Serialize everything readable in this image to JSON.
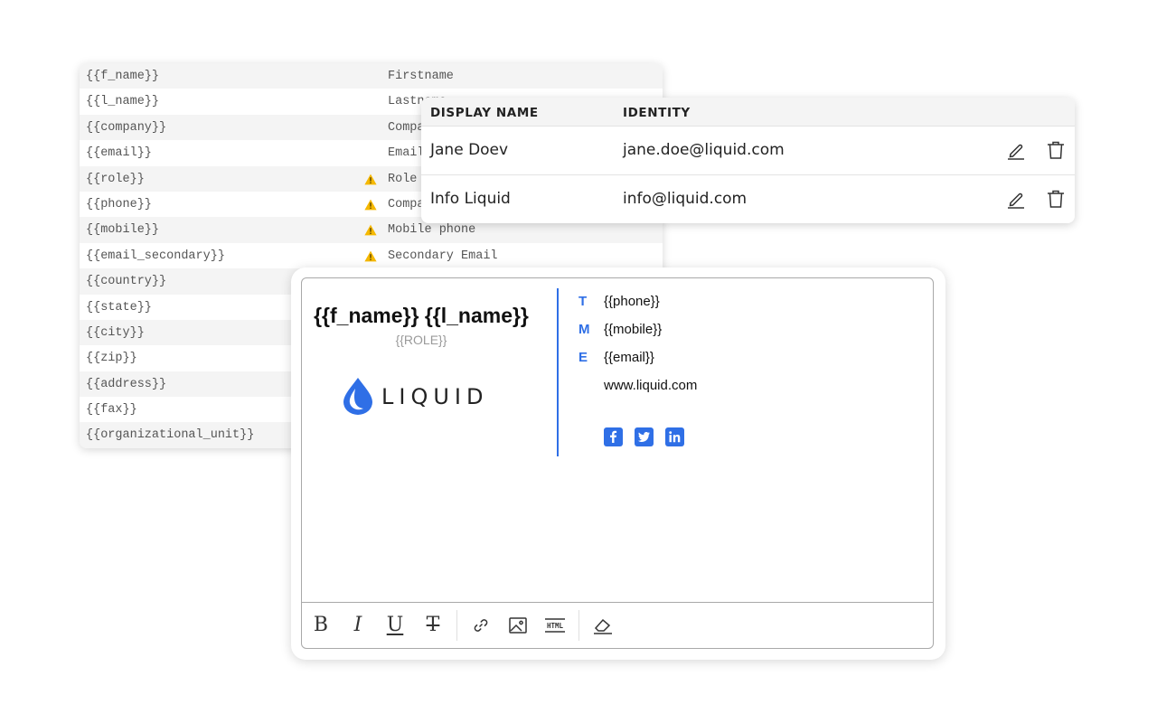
{
  "variables": {
    "rows": [
      {
        "key": "{{f_name}}",
        "label": "Firstname",
        "warning": false
      },
      {
        "key": "{{l_name}}",
        "label": "Lastname",
        "warning": false
      },
      {
        "key": "{{company}}",
        "label": "Company",
        "warning": false
      },
      {
        "key": "{{email}}",
        "label": "Email",
        "warning": false
      },
      {
        "key": "{{role}}",
        "label": "Role",
        "warning": true
      },
      {
        "key": "{{phone}}",
        "label": "Company phone",
        "warning": true
      },
      {
        "key": "{{mobile}}",
        "label": "Mobile phone",
        "warning": true
      },
      {
        "key": "{{email_secondary}}",
        "label": "Secondary Email",
        "warning": true
      },
      {
        "key": "{{country}}",
        "label": "",
        "warning": false
      },
      {
        "key": "{{state}}",
        "label": "",
        "warning": false
      },
      {
        "key": "{{city}}",
        "label": "",
        "warning": false
      },
      {
        "key": "{{zip}}",
        "label": "",
        "warning": false
      },
      {
        "key": "{{address}}",
        "label": "",
        "warning": false
      },
      {
        "key": "{{fax}}",
        "label": "",
        "warning": false
      },
      {
        "key": "{{organizational_unit}}",
        "label": "",
        "warning": false
      }
    ],
    "warning_color": "#f5b800"
  },
  "identities": {
    "columns": {
      "display_name": "DISPLAY NAME",
      "identity": "IDENTITY"
    },
    "rows": [
      {
        "display_name": "Jane Doev",
        "identity": "jane.doe@liquid.com",
        "edit_icon": "pencil-icon",
        "delete_icon": "trash-icon"
      },
      {
        "display_name": "Info Liquid",
        "identity": "info@liquid.com",
        "edit_icon": "pencil-icon",
        "delete_icon": "trash-icon"
      }
    ]
  },
  "signature": {
    "name": "{{f_name}} {{l_name}}",
    "role": "{{ROLE}}",
    "logo_text": "LIQUID",
    "accent_color": "#2f6fe6",
    "contacts": [
      {
        "letter": "T",
        "value": "{{phone}}"
      },
      {
        "letter": "M",
        "value": "{{mobile}}"
      },
      {
        "letter": "E",
        "value": "{{email}}"
      },
      {
        "letter": "",
        "value": "www.liquid.com"
      }
    ],
    "social_icons": [
      "facebook-icon",
      "twitter-icon",
      "linkedin-icon"
    ]
  },
  "toolbar": {
    "buttons": [
      "bold",
      "italic",
      "underline",
      "strikethrough",
      "link",
      "image",
      "html",
      "clear-format"
    ],
    "bold_glyph": "B",
    "italic_glyph": "I",
    "underline_glyph": "U",
    "strike_glyph": "T"
  }
}
